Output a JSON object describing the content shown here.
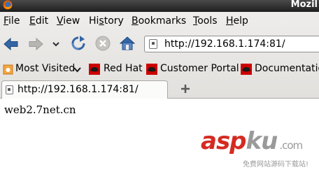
{
  "window": {
    "title": "Mozil"
  },
  "menubar": {
    "items": [
      {
        "label": "File",
        "key": "F"
      },
      {
        "label": "Edit",
        "key": "E"
      },
      {
        "label": "View",
        "key": "V"
      },
      {
        "label": "History",
        "key": "s"
      },
      {
        "label": "Bookmarks",
        "key": "B"
      },
      {
        "label": "Tools",
        "key": "T"
      },
      {
        "label": "Help",
        "key": "H"
      }
    ]
  },
  "navbar": {
    "url": "http://192.168.1.174:81/"
  },
  "bookmarks": {
    "most_visited": "Most Visited",
    "items": [
      "Red Hat",
      "Customer Portal",
      "Documentation"
    ]
  },
  "tabs": [
    {
      "label": "http://192.168.1.174:81/"
    }
  ],
  "page": {
    "text": "web2.7net.cn"
  },
  "watermark": {
    "brand_a": "asp",
    "brand_b": "ku",
    "brand_c": ".com",
    "sub": "免费网站源码下载站!"
  },
  "colors": {
    "accent_red": "#d52a21",
    "nav_blue": "#3465a4"
  }
}
